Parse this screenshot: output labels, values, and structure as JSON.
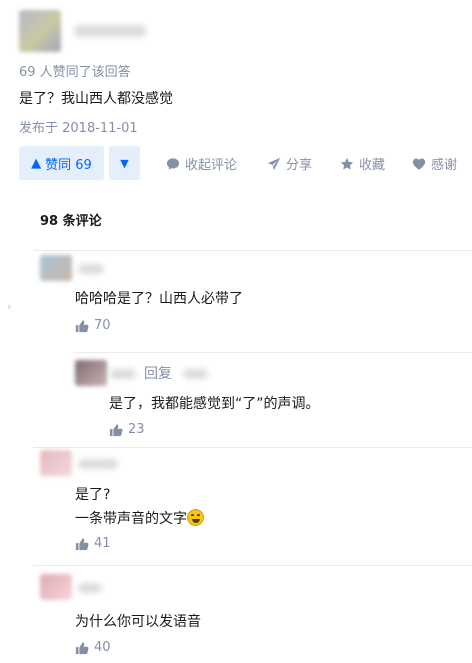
{
  "answer": {
    "votes_text": "69 人赞同了该回答",
    "content": "是了？我山西人都没感觉",
    "date": "发布于 2018-11-01"
  },
  "actions": {
    "vote_up_label": "赞同 69",
    "collapse_comments": "收起评论",
    "share": "分享",
    "favorite": "收藏",
    "thanks": "感谢"
  },
  "comments": {
    "title": "98 条评论",
    "items": [
      {
        "text": "哈哈哈是了？山西人必带了",
        "likes": "70"
      },
      {
        "reply_label": "回复",
        "text": "是了，我都能感觉到“了”的声调。",
        "likes": "23"
      },
      {
        "text_line1": "是了?",
        "text_line2": "一条带声音的文字",
        "likes": "41"
      },
      {
        "text": "为什么你可以发语音",
        "likes": "40"
      }
    ]
  },
  "colors": {
    "accent": "#0066ff",
    "accent_bg": "#e5eefb",
    "meta": "#8590a6"
  },
  "icons": [
    "triangle-up-icon",
    "triangle-down-icon",
    "comment-icon",
    "share-icon",
    "star-icon",
    "heart-icon",
    "thumb-up-icon",
    "grin-emoji-icon"
  ]
}
